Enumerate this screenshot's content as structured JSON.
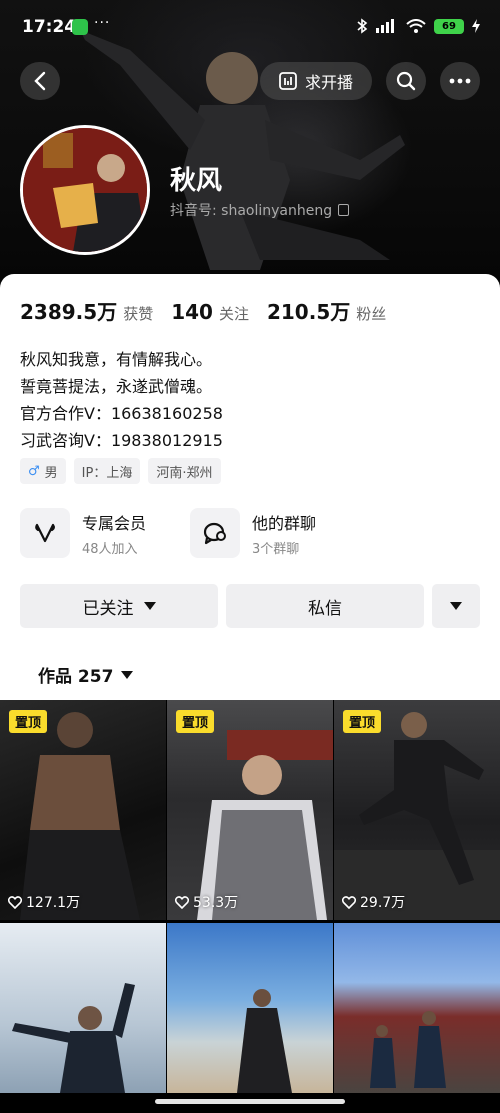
{
  "status_bar": {
    "time": "17:24",
    "dots": "···",
    "battery": "69",
    "icons": [
      "bluetooth-icon",
      "signal-icon",
      "wifi-icon",
      "battery-icon",
      "charging-icon"
    ]
  },
  "top_bar": {
    "stream_label": "求开播"
  },
  "profile": {
    "name": "秋风",
    "douyin_id": "抖音号: shaolinyanheng"
  },
  "stats": [
    {
      "value": "2389.5万",
      "label": "获赞"
    },
    {
      "value": "140",
      "label": "关注"
    },
    {
      "value": "210.5万",
      "label": "粉丝"
    }
  ],
  "bio": [
    "秋风知我意，有情解我心。",
    "誓竟菩提法，永遂武僧魂。",
    "官方合作V：16638160258",
    "习武咨询V：19838012915"
  ],
  "tags": {
    "gender": "男",
    "ip": "IP：上海",
    "location": "河南·郑州"
  },
  "features": {
    "membership": {
      "title": "专属会员",
      "sub": "48人加入"
    },
    "group_chat": {
      "title": "他的群聊",
      "sub": "3个群聊"
    }
  },
  "actions": {
    "follow_label": "已关注",
    "message_label": "私信"
  },
  "works": {
    "label": "作品 257"
  },
  "videos": [
    {
      "pinned": "置顶",
      "likes": "127.1万"
    },
    {
      "pinned": "置顶",
      "likes": "53.3万"
    },
    {
      "pinned": "置顶",
      "likes": "29.7万"
    },
    {
      "pinned": "",
      "likes": ""
    },
    {
      "pinned": "",
      "likes": ""
    },
    {
      "pinned": "",
      "likes": ""
    }
  ],
  "colors": {
    "pin_badge": "#fadc2c",
    "male": "#3a8ef2",
    "battery": "#3fd24a"
  }
}
